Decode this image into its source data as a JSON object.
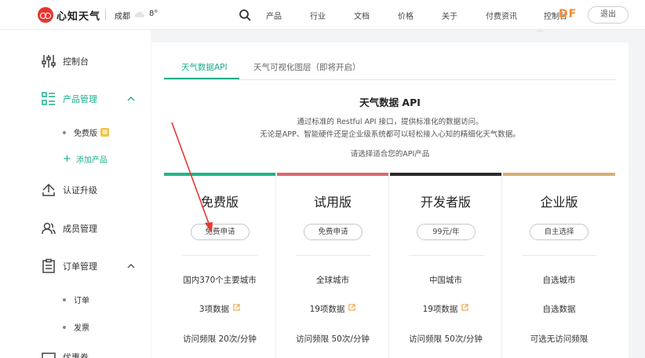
{
  "header": {
    "brand": "心知天气",
    "city": "成都",
    "temperature": "8°",
    "nav": [
      "产品",
      "行业",
      "文档",
      "价格",
      "关于",
      "付费资讯",
      "控制台"
    ],
    "watermark": "DF",
    "login_label": "退出"
  },
  "sidebar": {
    "console": "控制台",
    "product_mgmt": "产品管理",
    "free_version": "免费版",
    "add_product": "添加产品",
    "cert_upgrade": "认证升级",
    "member_mgmt": "成员管理",
    "order_mgmt": "订单管理",
    "orders": "订单",
    "invoice": "发票",
    "coupons": "优惠券"
  },
  "main": {
    "tabs": [
      "天气数据API",
      "天气可视化图层（即将开启）"
    ],
    "title": "天气数据 API",
    "desc_line1": "通过标准的 Restful API 接口，提供标准化的数据访问。",
    "desc_line2": "无论是APP、智能硬件还是企业级系统都可以轻松接入心知的精细化天气数据。",
    "choose": "请选择适合您的API产品",
    "plans": [
      {
        "name": "免费版",
        "button": "免费申请",
        "coverage": "国内370个主要城市",
        "data_items": "3项数据",
        "rate": "访问频限 20次/分钟",
        "color": "#1fb489"
      },
      {
        "name": "试用版",
        "button": "免费申请",
        "coverage": "全球城市",
        "data_items": "19项数据",
        "rate": "访问频限 50次/分钟",
        "color": "#d9686c"
      },
      {
        "name": "开发者版",
        "button": "99元/年",
        "coverage": "中国城市",
        "data_items": "19项数据",
        "rate": "访问频限 50次/分钟",
        "color": "#2b2b2b"
      },
      {
        "name": "企业版",
        "button": "自主选择",
        "coverage": "自选城市",
        "data_items": "自选数据",
        "rate": "可选无访问频限",
        "color": "#d7ae77"
      }
    ]
  }
}
